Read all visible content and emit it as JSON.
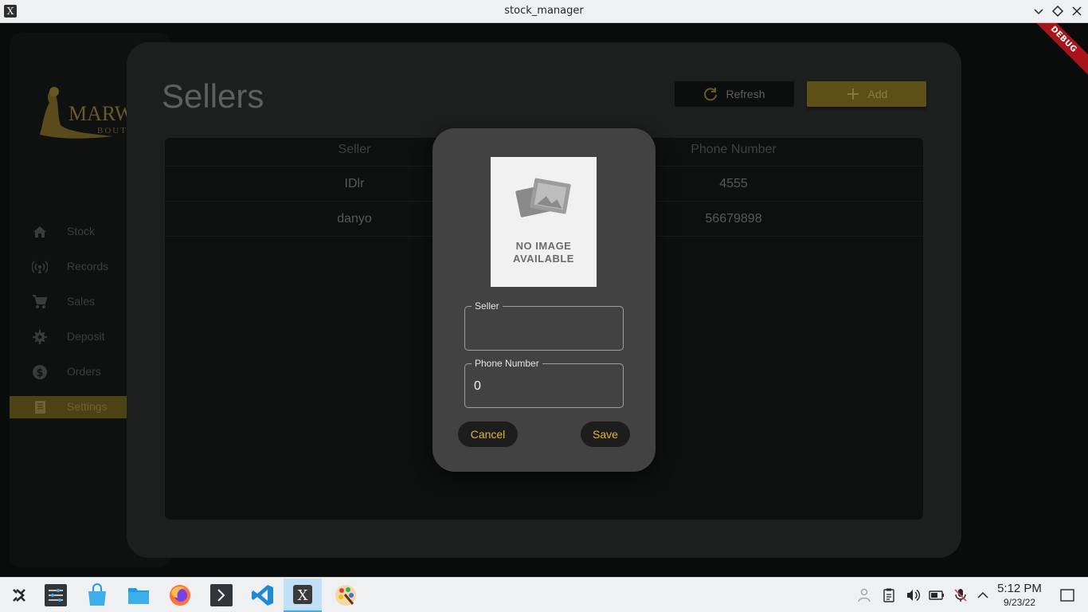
{
  "window": {
    "title": "stock_manager"
  },
  "debug_banner": "DEBUG",
  "sidebar": {
    "logo_text": "MARW",
    "logo_sub": "BOUTI",
    "items": [
      {
        "label": "Stock",
        "icon": "home-icon"
      },
      {
        "label": "Records",
        "icon": "broadcast-icon"
      },
      {
        "label": "Sales",
        "icon": "cart-icon"
      },
      {
        "label": "Deposit",
        "icon": "gear-icon"
      },
      {
        "label": "Orders",
        "icon": "dollar-icon"
      },
      {
        "label": "Settings",
        "icon": "book-icon",
        "active": true
      }
    ]
  },
  "page": {
    "title": "Sellers",
    "refresh_label": "Refresh",
    "add_label": "Add"
  },
  "table": {
    "columns": [
      "Seller",
      "Phone Number"
    ],
    "rows": [
      [
        "IDlr",
        "4555"
      ],
      [
        "danyo",
        "56679898"
      ]
    ]
  },
  "dialog": {
    "image_text_line1": "NO IMAGE",
    "image_text_line2": "AVAILABLE",
    "seller_label": "Seller",
    "seller_value": "",
    "phone_label": "Phone Number",
    "phone_value": "0",
    "cancel_label": "Cancel",
    "save_label": "Save"
  },
  "taskbar": {
    "time": "5:12 PM",
    "date": "9/23/22"
  },
  "colors": {
    "accent": "#e0b537",
    "active_nav": "#4d4213",
    "dialog_bg": "#424242"
  }
}
